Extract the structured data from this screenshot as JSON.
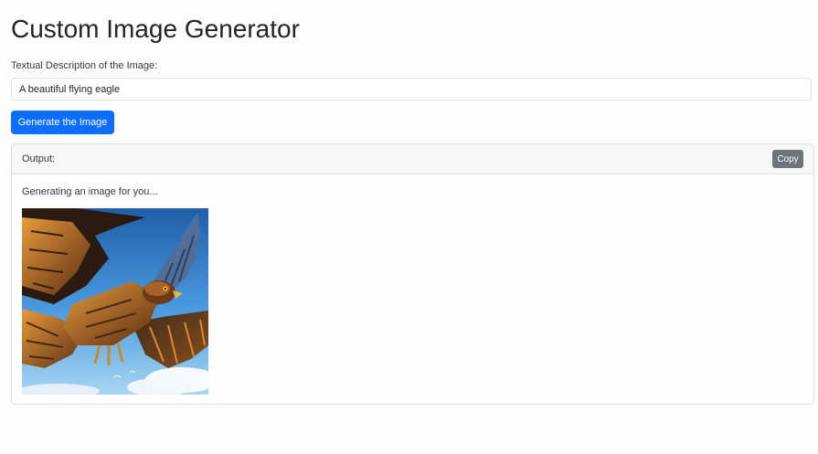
{
  "page": {
    "title": "Custom Image Generator"
  },
  "form": {
    "description_label": "Textual Description of the Image:",
    "description_value": "A beautiful flying eagle",
    "generate_label": "Generate the Image"
  },
  "output": {
    "header_label": "Output:",
    "copy_label": "Copy",
    "status_text": "Generating an image for you...",
    "image_subject": "flying-eagle-image"
  },
  "colors": {
    "primary": "#0d6efd",
    "secondary": "#6c757d",
    "border": "#dee2e6",
    "header_bg": "#f7f7f8"
  }
}
